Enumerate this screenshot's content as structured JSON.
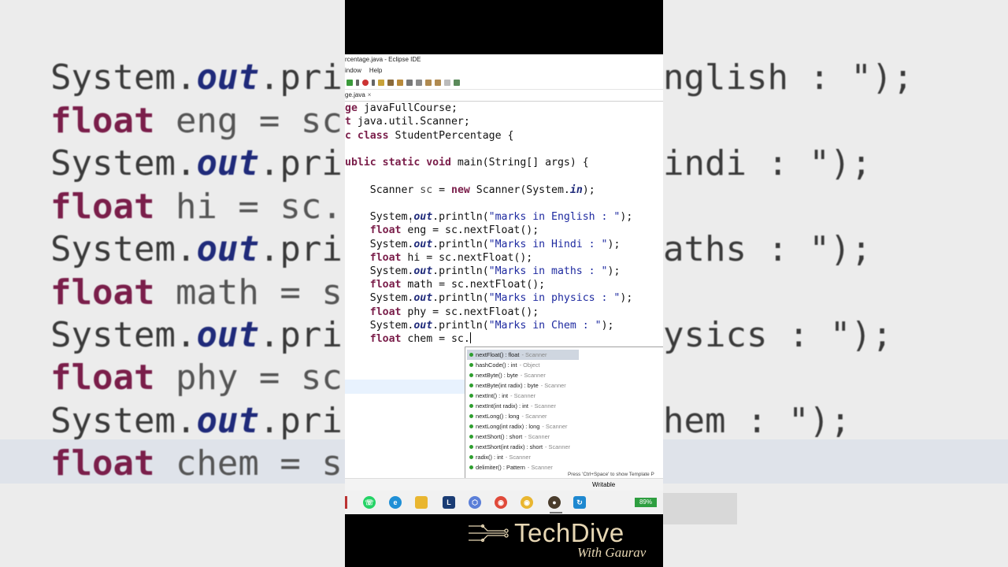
{
  "background": {
    "lines": [
      {
        "kind": "println",
        "text_left": "System.",
        "text_out": "out",
        "text_mid": ".prin",
        "text_right": "nglish : \");"
      },
      {
        "kind": "float",
        "kw": "float",
        "text_left": " eng = sc."
      },
      {
        "kind": "println",
        "text_left": "System.",
        "text_out": "out",
        "text_mid": ".prin",
        "text_right": "indi : \");"
      },
      {
        "kind": "float",
        "kw": "float",
        "text_left": " hi = sc.n"
      },
      {
        "kind": "println",
        "text_left": "System.",
        "text_out": "out",
        "text_mid": ".prin",
        "text_right": "aths : \");"
      },
      {
        "kind": "float",
        "kw": "float",
        "text_left": " math = sc"
      },
      {
        "kind": "println",
        "text_left": "System.",
        "text_out": "out",
        "text_mid": ".prin",
        "text_right": "ysics : \");"
      },
      {
        "kind": "float",
        "kw": "float",
        "text_left": " phy = sc."
      },
      {
        "kind": "println",
        "text_left": "System.",
        "text_out": "out",
        "text_mid": ".prin",
        "text_right": "hem : \");"
      },
      {
        "kind": "float",
        "kw": "float",
        "text_left": " chem = sc"
      }
    ]
  },
  "window": {
    "title": "rcentage.java - Eclipse IDE",
    "menu": [
      "indow",
      "Help"
    ],
    "tab_label": "ge.java",
    "tab_close": "×"
  },
  "code": {
    "l1_kw": "ge",
    "l1_rest": " javaFullCourse;",
    "l2_kw": "t",
    "l2_rest": " java.util.Scanner;",
    "l3_kw1": "c",
    "l3_kw2": "class",
    "l3_rest": " StudentPercentage {",
    "l4_kw": "ublic static void",
    "l4_rest": " main(String[] args) {",
    "l5_a": "    Scanner ",
    "l5_var": "sc",
    "l5_b": " = ",
    "l5_kw": "new",
    "l5_c": " Scanner(System.",
    "l5_fld": "in",
    "l5_d": ");",
    "println_prefix": "    System.",
    "out": "out",
    "println_mid": ".println(",
    "println_end": ");",
    "float_kw": "float",
    "s1": "\"marks in English : \"",
    "f1": " eng = sc.nextFloat();",
    "s2": "\"Marks in Hindi : \"",
    "f2": " hi = sc.nextFloat();",
    "s3": "\"Marks in maths : \"",
    "f3": " math = sc.nextFloat();",
    "s4": "\"Marks in physics : \"",
    "f4": " phy = sc.nextFloat();",
    "s5": "\"Marks in Chem : \"",
    "f5": " chem = sc."
  },
  "autocomplete": {
    "items": [
      {
        "sig": "nextFloat() : float",
        "owner": "- Scanner"
      },
      {
        "sig": "hashCode() : int",
        "owner": "- Object"
      },
      {
        "sig": "nextByte() : byte",
        "owner": "- Scanner"
      },
      {
        "sig": "nextByte(int radix) : byte",
        "owner": "- Scanner"
      },
      {
        "sig": "nextInt() : int",
        "owner": "- Scanner"
      },
      {
        "sig": "nextInt(int radix) : int",
        "owner": "- Scanner"
      },
      {
        "sig": "nextLong() : long",
        "owner": "- Scanner"
      },
      {
        "sig": "nextLong(int radix) : long",
        "owner": "- Scanner"
      },
      {
        "sig": "nextShort() : short",
        "owner": "- Scanner"
      },
      {
        "sig": "nextShort(int radix) : short",
        "owner": "- Scanner"
      },
      {
        "sig": "radix() : int",
        "owner": "- Scanner"
      },
      {
        "sig": "delimiter() : Pattern",
        "owner": "- Scanner"
      }
    ],
    "hint": "Press 'Ctrl+Space' to show Template P"
  },
  "status": {
    "mode": "Writable"
  },
  "taskbar": {
    "battery": "89%",
    "badge": "1"
  },
  "branding": {
    "title": "TechDive",
    "subtitle": "With Gaurav"
  },
  "colors": {
    "keyword": "#7a1e4a",
    "field": "#1f2a7a",
    "string": "#1e2aa0",
    "battery": "#2e9e40",
    "logo": "#e7d7b4"
  }
}
